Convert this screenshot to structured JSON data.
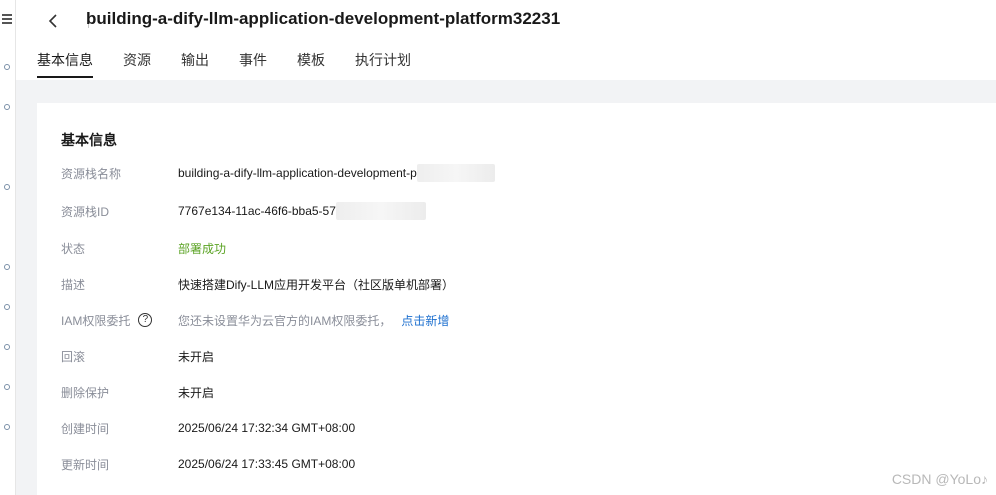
{
  "header": {
    "title": "building-a-dify-llm-application-development-platform32231"
  },
  "tabs": [
    {
      "label": "基本信息",
      "active": true
    },
    {
      "label": "资源",
      "active": false
    },
    {
      "label": "输出",
      "active": false
    },
    {
      "label": "事件",
      "active": false
    },
    {
      "label": "模板",
      "active": false
    },
    {
      "label": "执行计划",
      "active": false
    }
  ],
  "card": {
    "title": "基本信息",
    "rows": {
      "stack_name": {
        "label": "资源栈名称",
        "value": "building-a-dify-llm-application-development-p"
      },
      "stack_id": {
        "label": "资源栈ID",
        "value": "7767e134-11ac-46f6-bba5-57"
      },
      "status": {
        "label": "状态",
        "value": "部署成功"
      },
      "description": {
        "label": "描述",
        "value": "快速搭建Dify-LLM应用开发平台（社区版单机部署）"
      },
      "iam": {
        "label": "IAM权限委托",
        "value": "您还未设置华为云官方的IAM权限委托，",
        "link": "点击新增"
      },
      "rollback": {
        "label": "回滚",
        "value": "未开启"
      },
      "delete_protection": {
        "label": "删除保护",
        "value": "未开启"
      },
      "created": {
        "label": "创建时间",
        "value": "2025/06/24 17:32:34 GMT+08:00"
      },
      "updated": {
        "label": "更新时间",
        "value": "2025/06/24 17:33:45 GMT+08:00"
      }
    }
  },
  "colors": {
    "success": "#5ba324",
    "link": "#1c6fcf",
    "label": "#8a8e99",
    "background": "#f2f3f5"
  },
  "watermark": "CSDN @YoLo♪"
}
